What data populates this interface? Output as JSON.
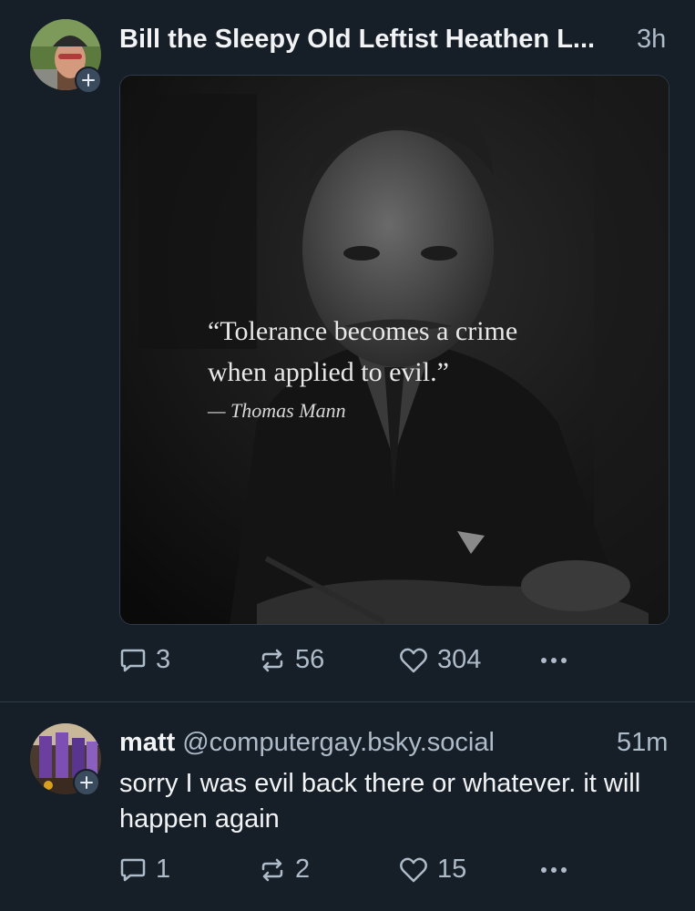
{
  "posts": [
    {
      "display_name": "Bill the Sleepy Old Leftist Heathen L...",
      "timestamp": "3h",
      "image": {
        "quote_lines": [
          "“Tolerance becomes a crime",
          "when applied to evil.”"
        ],
        "attribution": "— Thomas Mann"
      },
      "actions": {
        "replies": "3",
        "reposts": "56",
        "likes": "304"
      },
      "icons": [
        "reply-icon",
        "repost-icon",
        "heart-icon",
        "more-icon"
      ]
    },
    {
      "display_name": "matt",
      "handle": "@computergay.bsky.social",
      "timestamp": "51m",
      "text": "sorry I was evil back there or whatever. it will happen again",
      "actions": {
        "replies": "1",
        "reposts": "2",
        "likes": "15"
      },
      "icons": [
        "reply-icon",
        "repost-icon",
        "heart-icon",
        "more-icon"
      ]
    }
  ],
  "colors": {
    "background": "#161e27",
    "muted_text": "#aebbc9",
    "divider": "#2e3b49",
    "badge": "#3b4b5e"
  }
}
